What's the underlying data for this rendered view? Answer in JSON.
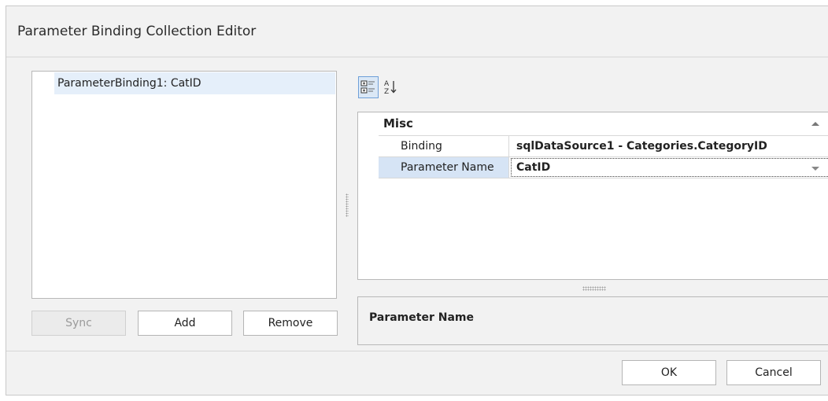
{
  "window": {
    "title": "Parameter Binding Collection Editor"
  },
  "collection": {
    "items": [
      {
        "label": "ParameterBinding1: CatID",
        "selected": true
      }
    ]
  },
  "buttons": {
    "sync": "Sync",
    "add": "Add",
    "remove": "Remove",
    "ok": "OK",
    "cancel": "Cancel"
  },
  "toolbar": {
    "categorized_icon": "categorized-view-icon",
    "alphabetical_icon": "sort-alphabetical-icon",
    "active": "categorized"
  },
  "property_grid": {
    "category": "Misc",
    "rows": [
      {
        "name": "Binding",
        "value": "sqlDataSource1 - Categories.CategoryID"
      },
      {
        "name": "Parameter Name",
        "value": "CatID"
      }
    ]
  },
  "description": {
    "title": "Parameter Name"
  },
  "colors": {
    "selection": "#e5effa",
    "grid_selection": "#d6e4f5",
    "toolbar_active": "#dbe8f6"
  }
}
